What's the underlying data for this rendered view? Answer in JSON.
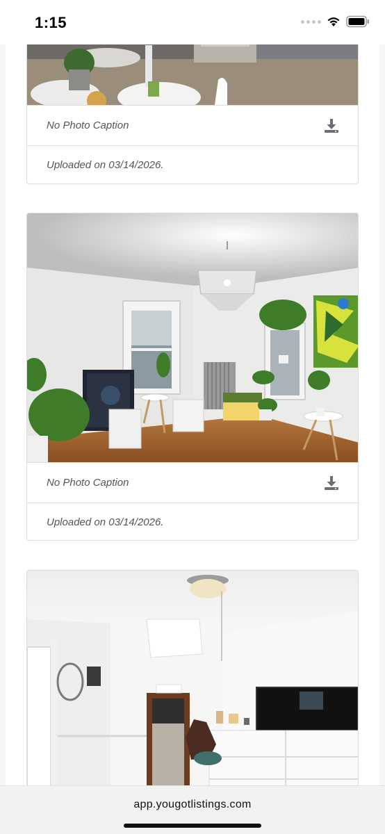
{
  "status_bar": {
    "time": "1:15"
  },
  "listing_photos": [
    {
      "caption": "No Photo Caption",
      "uploaded": "Uploaded on 03/14/2026."
    },
    {
      "caption": "No Photo Caption",
      "uploaded": "Uploaded on 03/14/2026."
    }
  ],
  "browser": {
    "url": "app.yougotlistings.com"
  },
  "icons": {
    "download": "download-icon",
    "wifi": "wifi-icon",
    "battery": "battery-icon"
  },
  "colors": {
    "icon_gray": "#6b6f74",
    "caption_text": "#555555",
    "border": "#dcdcdc"
  }
}
